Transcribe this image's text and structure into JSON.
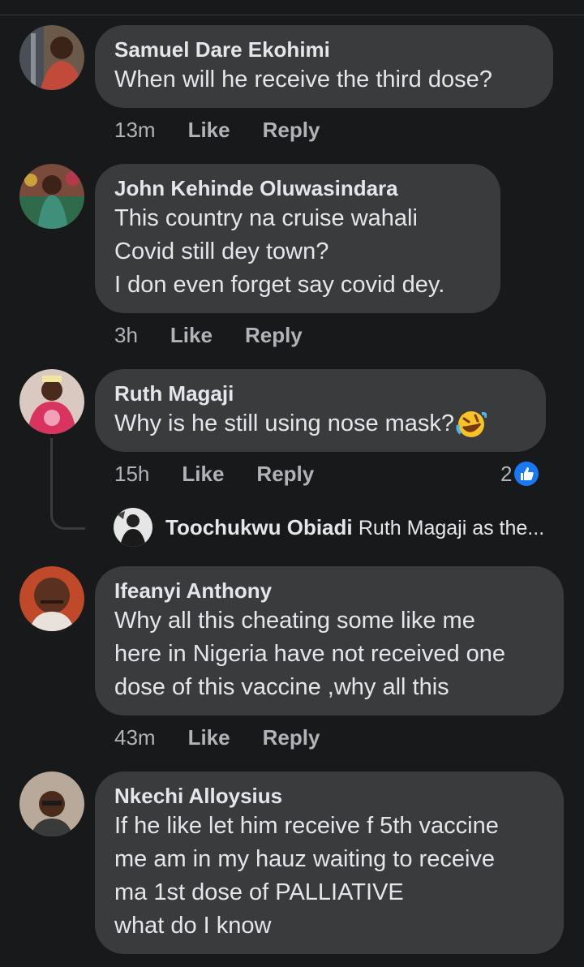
{
  "comments": [
    {
      "name": "Samuel Dare Ekohimi",
      "lines": [
        "When will he receive the third dose?"
      ],
      "time": "13m",
      "like": "Like",
      "reply": "Reply"
    },
    {
      "name": "John Kehinde Oluwasindara",
      "lines": [
        "This country na cruise wahali",
        "Covid still dey town?",
        "I don even forget say covid dey."
      ],
      "time": "3h",
      "like": "Like",
      "reply": "Reply"
    },
    {
      "name": "Ruth Magaji",
      "lines": [
        "Why is he still using nose mask?"
      ],
      "emoji": "rolling-on-floor-laughing-emoji",
      "time": "15h",
      "like": "Like",
      "reply": "Reply",
      "reaction_count": "2",
      "reaction_icon": "like-reaction-icon",
      "reply_preview": {
        "name": "Toochukwu Obiadi",
        "text": "Ruth Magaji  as the..."
      }
    },
    {
      "name": "Ifeanyi Anthony",
      "lines": [
        "Why all this cheating some like me",
        "here in Nigeria have not received one",
        "dose of this vaccine ,why all this"
      ],
      "time": "43m",
      "like": "Like",
      "reply": "Reply"
    },
    {
      "name": "Nkechi Alloysius",
      "lines": [
        "If he like let him receive f 5th vaccine",
        "me am in my hauz waiting to receive",
        "ma 1st dose of PALLIATIVE",
        "what do I know"
      ]
    }
  ],
  "colors": {
    "background": "#18191a",
    "bubble": "#3a3b3c",
    "text": "#e4e6eb",
    "secondary_text": "#b0b3b8",
    "like_blue": "#1877f2"
  }
}
